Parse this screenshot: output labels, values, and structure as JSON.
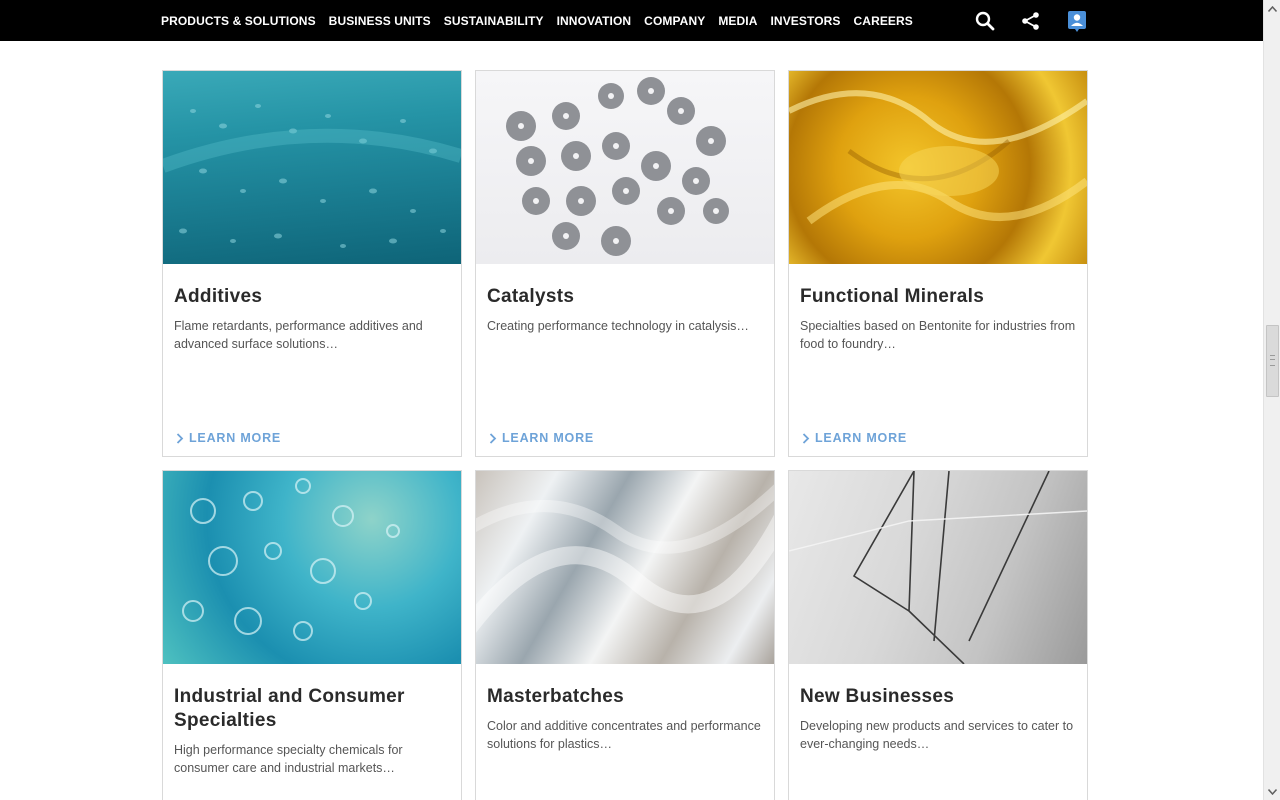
{
  "nav": {
    "items": [
      "PRODUCTS & SOLUTIONS",
      "BUSINESS UNITS",
      "SUSTAINABILITY",
      "INNOVATION",
      "COMPANY",
      "MEDIA",
      "INVESTORS",
      "CAREERS"
    ],
    "icons": [
      "search-icon",
      "share-icon",
      "contact-icon"
    ]
  },
  "cards": [
    {
      "title": "Additives",
      "desc": "Flame retardants, performance additives and advanced surface solutions…",
      "link": "LEARN MORE"
    },
    {
      "title": "Catalysts",
      "desc": "Creating performance technology in catalysis…",
      "link": "LEARN MORE"
    },
    {
      "title": "Functional Minerals",
      "desc": "Specialties based on Bentonite for industries from food to foundry…",
      "link": "LEARN MORE"
    },
    {
      "title": "Industrial and Consumer Specialties",
      "desc": "High performance specialty chemicals for consumer care and industrial markets…"
    },
    {
      "title": "Masterbatches",
      "desc": "Color and additive concentrates and performance solutions for plastics…"
    },
    {
      "title": "New Businesses",
      "desc": "Developing new products and services to cater to ever-changing needs…"
    }
  ],
  "colors": {
    "nav_bg": "#000000",
    "link": "#6ea3d8",
    "title": "#2a2a2a"
  }
}
